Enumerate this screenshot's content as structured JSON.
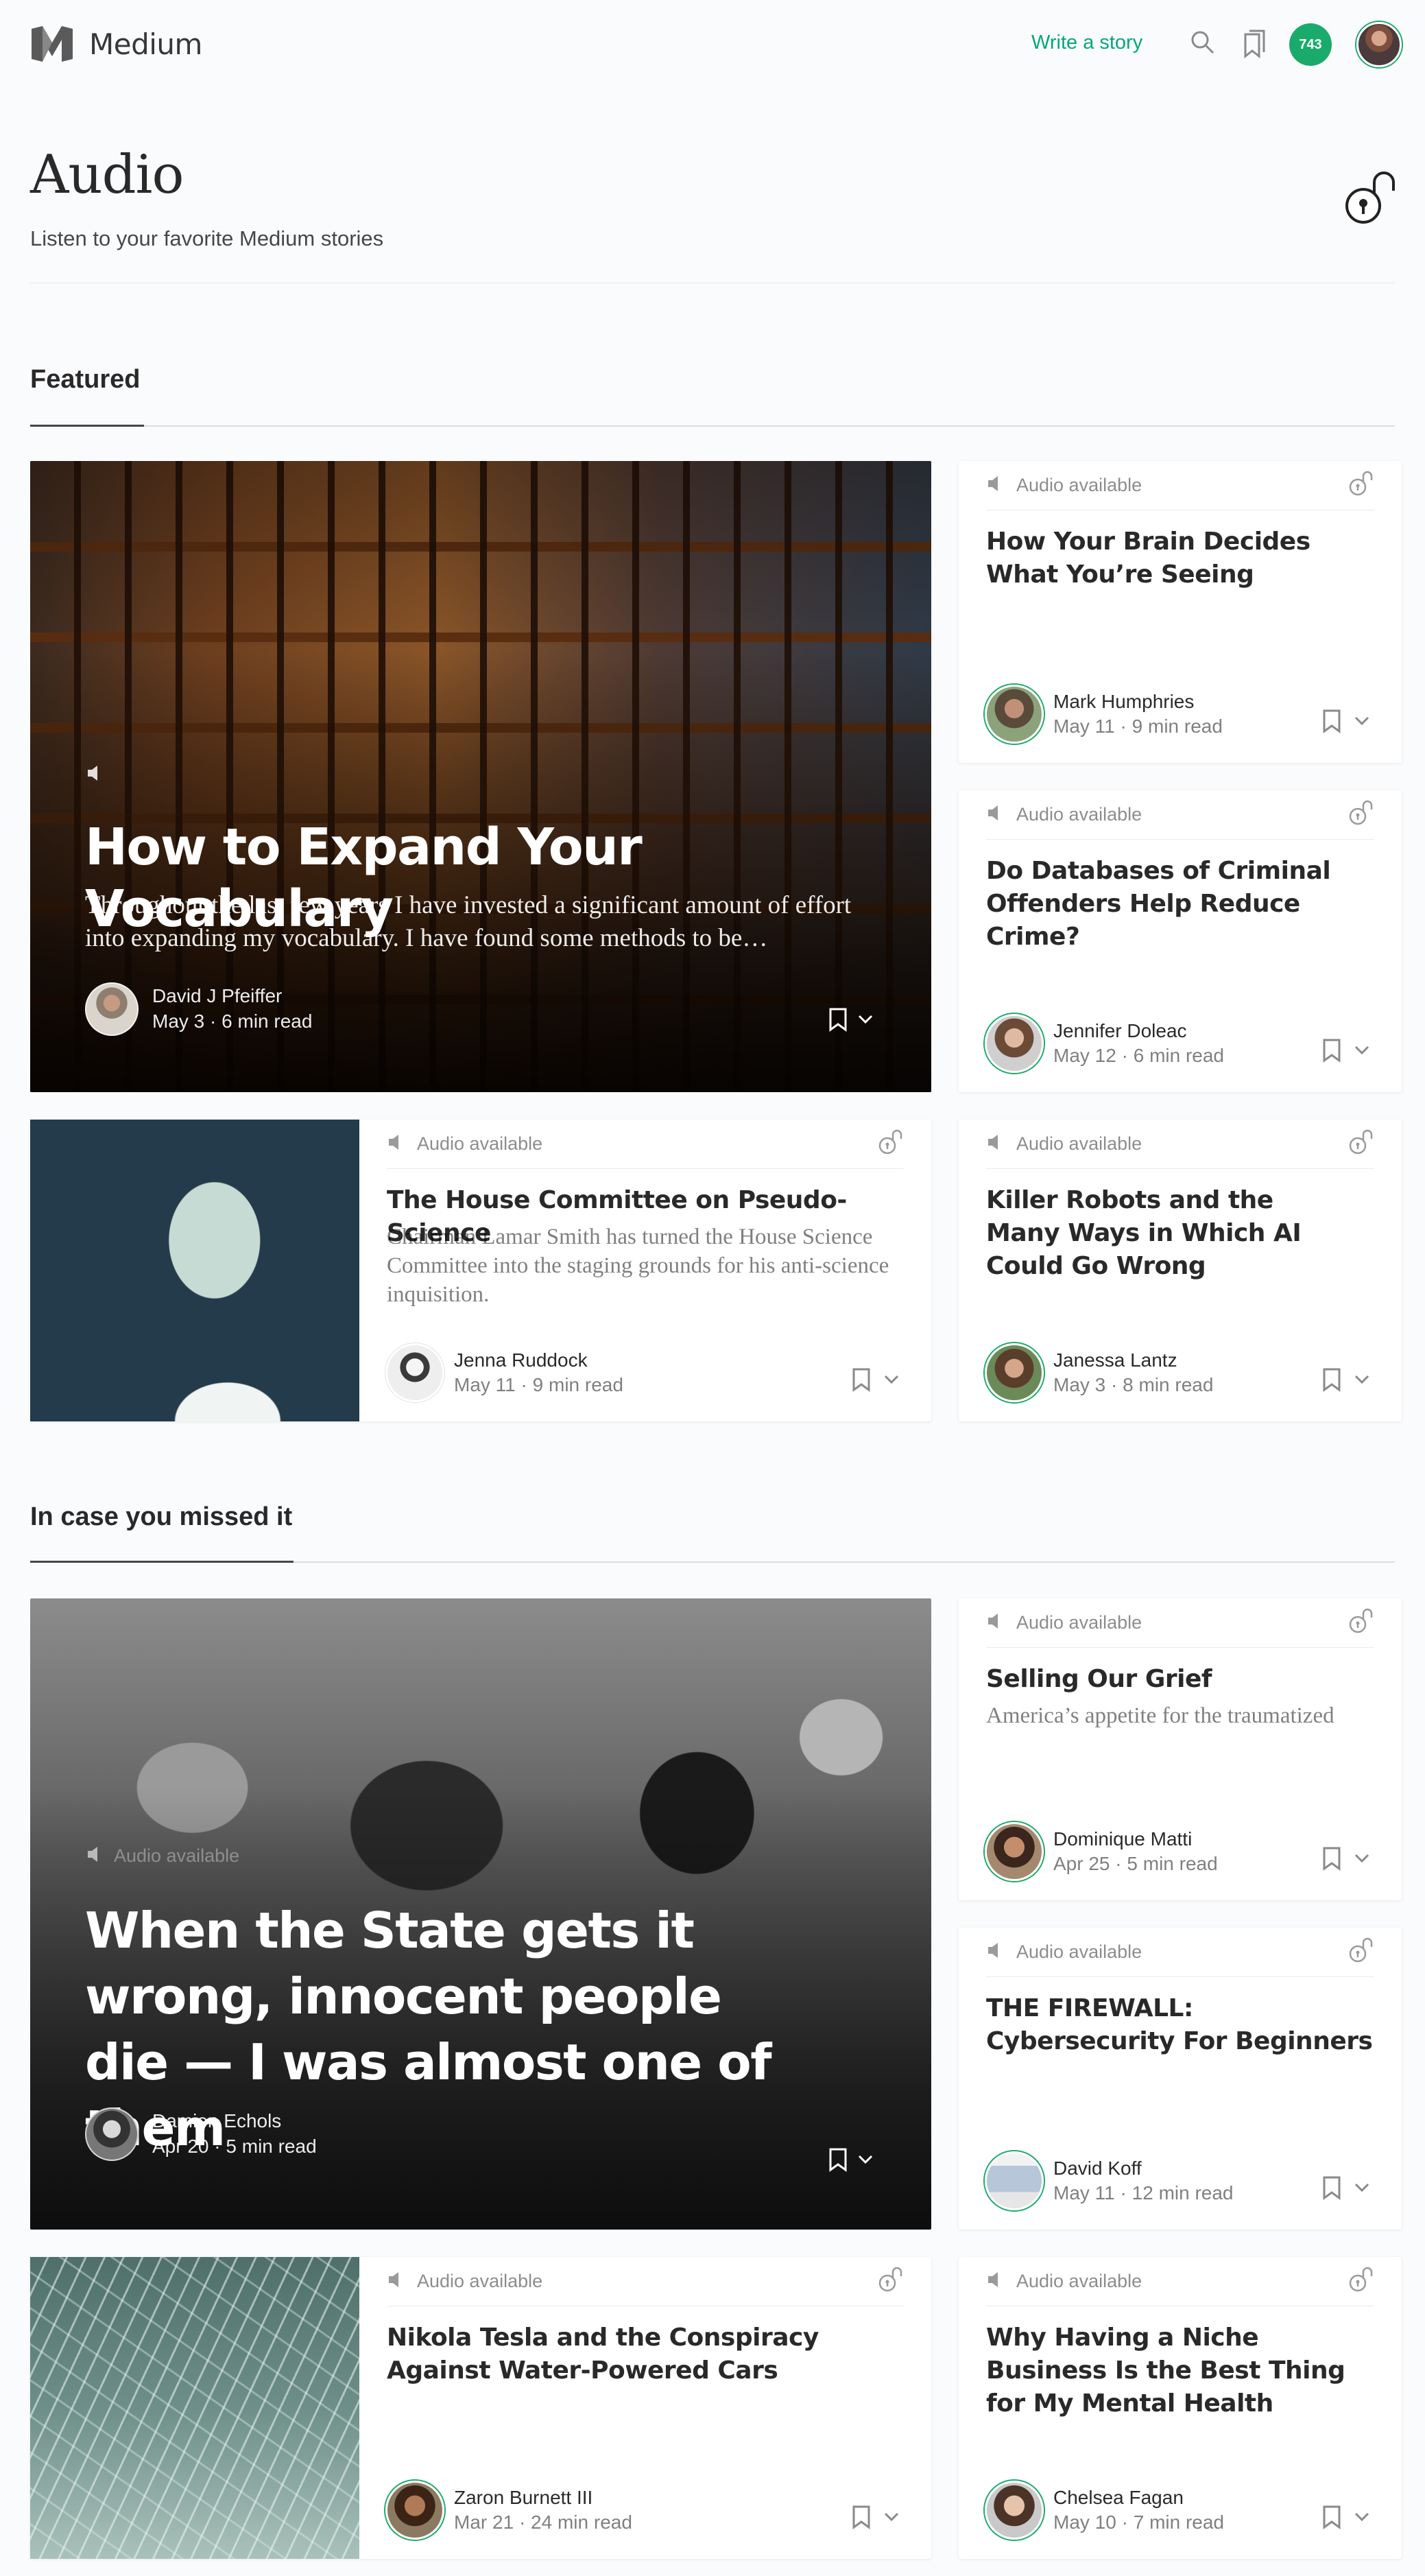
{
  "header": {
    "brand": "Medium",
    "write_link": "Write a story",
    "notification_count": "743",
    "accent": "#03a87c"
  },
  "page": {
    "title": "Audio",
    "subtitle": "Listen to your favorite Medium stories"
  },
  "sections": {
    "featured": {
      "heading": "Featured",
      "hero": {
        "title": "How to Expand Your Vocabulary",
        "description": "Throughout the last few years I have invested a significant amount of effort into expanding my vocabulary. I have found some methods to be…",
        "author": "David J Pfeiffer",
        "date": "May 3",
        "read_time": "6 min read"
      },
      "cards": [
        {
          "audio": "Audio available",
          "title": "How Your Brain Decides What You’re Seeing",
          "author": "Mark Humphries",
          "date": "May 11",
          "read_time": "9 min read"
        },
        {
          "audio": "Audio available",
          "title": "Do Databases of Criminal Offenders Help Reduce Crime?",
          "author": "Jennifer Doleac",
          "date": "May 12",
          "read_time": "6 min read"
        },
        {
          "audio": "Audio available",
          "title": "The House Committee on Pseudo-Science",
          "subtitle": "Chairman Lamar Smith has turned the House Science Committee into the staging grounds for his anti-science inquisition.",
          "author": "Jenna Ruddock",
          "date": "May 11",
          "read_time": "9 min read"
        },
        {
          "audio": "Audio available",
          "title": "Killer Robots and the Many Ways in Which AI Could Go Wrong",
          "author": "Janessa Lantz",
          "date": "May 3",
          "read_time": "8 min read"
        }
      ]
    },
    "missed": {
      "heading": "In case you missed it",
      "hero": {
        "audio": "Audio available",
        "title": "When the State gets it wrong, innocent people die — I was almost one of them",
        "author": "Damien Echols",
        "date": "Apr 20",
        "read_time": "5 min read"
      },
      "cards": [
        {
          "audio": "Audio available",
          "title": "Selling Our Grief",
          "subtitle": "America’s appetite for the traumatized",
          "author": "Dominique Matti",
          "date": "Apr 25",
          "read_time": "5 min read"
        },
        {
          "audio": "Audio available",
          "title": "THE FIREWALL: Cybersecurity For Beginners",
          "author": "David Koff",
          "date": "May 11",
          "read_time": "12 min read"
        },
        {
          "audio": "Audio available",
          "title": "Nikola Tesla and the Conspiracy Against Water-Powered Cars",
          "author": "Zaron Burnett III",
          "date": "Mar 21",
          "read_time": "24 min read"
        },
        {
          "audio": "Audio available",
          "title": "Why Having a Niche Business Is the Best Thing for My Mental Health",
          "author": "Chelsea Fagan",
          "date": "May 10",
          "read_time": "7 min read"
        }
      ]
    }
  },
  "icons": {
    "logo": "medium-logo-icon",
    "search": "search-icon",
    "bookmarks": "bookmarks-icon",
    "lock": "unlock-icon",
    "speaker": "speaker-icon",
    "bookmark": "bookmark-icon",
    "chevron": "chevron-down-icon"
  },
  "sep": "·"
}
